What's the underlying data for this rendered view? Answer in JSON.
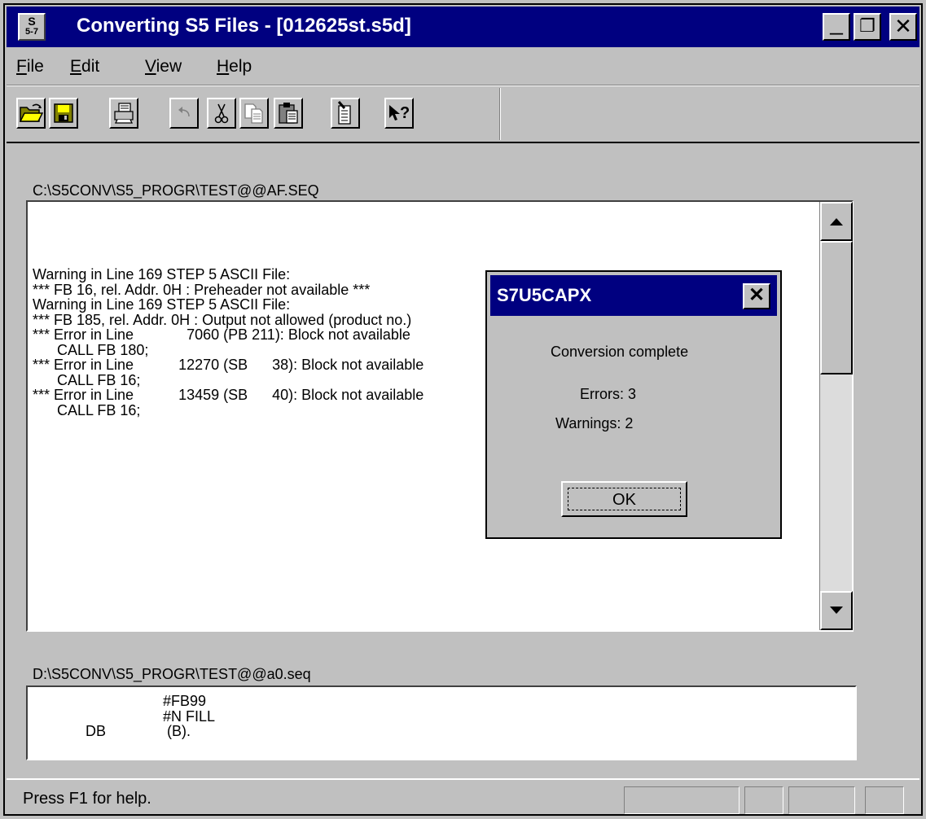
{
  "window": {
    "title": "Converting S5 Files - [012625st.s5d]",
    "app_icon_top": "S",
    "app_icon_bottom": "5-7",
    "minimize_glyph": "_",
    "restore_glyph": "❐",
    "close_glyph": "✕"
  },
  "menu": {
    "file": {
      "accel": "F",
      "rest": "ile"
    },
    "edit": {
      "accel": "E",
      "rest": "dit"
    },
    "view": {
      "accel": "V",
      "rest": "iew"
    },
    "help": {
      "accel": "H",
      "rest": "elp"
    }
  },
  "toolbar": {
    "icons": [
      "open-folder-icon",
      "save-icon",
      "print-icon",
      "undo-icon",
      "cut-icon",
      "copy-icon",
      "paste-icon",
      "edit-document-icon",
      "context-help-icon"
    ]
  },
  "source_pane": {
    "path": "C:\\S5CONV\\S5_PROGR\\TEST@@AF.SEQ",
    "lines": [
      "Warning in Line 169 STEP 5 ASCII File:",
      "*** FB 16, rel. Addr. 0H : Preheader not available ***",
      "Warning in Line 169 STEP 5 ASCII File:",
      "*** FB 185, rel. Addr. 0H : Output not allowed (product no.)",
      "*** Error in Line             7060 (PB 211): Block not available",
      "      CALL FB 180;",
      "*** Error in Line           12270 (SB      38): Block not available",
      "      CALL FB 16;",
      "*** Error in Line           13459 (SB      40): Block not available",
      "      CALL FB 16;"
    ]
  },
  "dest_pane": {
    "path": "D:\\S5CONV\\S5_PROGR\\TEST@@a0.seq",
    "lines": [
      "                                #FB99",
      "                                #N FILL",
      "             DB               (B)."
    ]
  },
  "dialog": {
    "title": "S7U5CAPX",
    "close_glyph": "✕",
    "message": "Conversion complete",
    "errors": "Errors: 3",
    "warnings": "Warnings: 2",
    "ok_label": "OK"
  },
  "status": {
    "text": "Press F1 for help."
  }
}
